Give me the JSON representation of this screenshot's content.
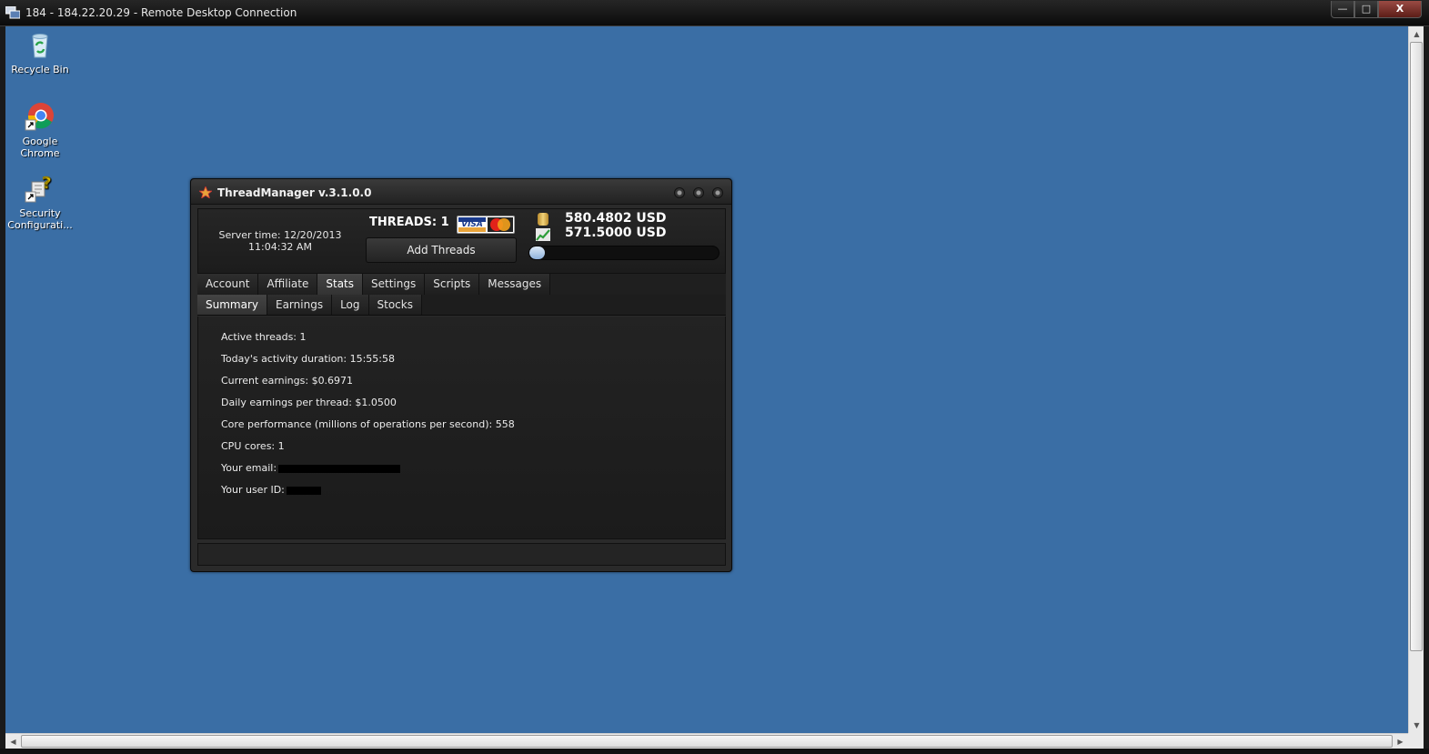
{
  "rdp": {
    "title": "184 - 184.22.20.29 - Remote Desktop Connection",
    "min_label": "—",
    "max_label": "□",
    "close_label": "X"
  },
  "desktop": {
    "background": "#3a6ea5",
    "icons": [
      {
        "label": "Recycle Bin",
        "icon": "recycle-bin-icon"
      },
      {
        "label": "Google Chrome",
        "icon": "chrome-icon"
      },
      {
        "label": "Security Configurati...",
        "icon": "security-config-icon"
      }
    ]
  },
  "app": {
    "title": "ThreadManager v.3.1.0.0",
    "server_time_line1": "Server time: 12/20/2013",
    "server_time_line2": "11:04:32 AM",
    "threads_label": "THREADS: 1",
    "visa_label": "VISA",
    "add_threads_label": "Add Threads",
    "balance": "580.4802 USD",
    "earned": "571.5000 USD",
    "progress_fraction": 0.08,
    "main_tabs": [
      "Account",
      "Affiliate",
      "Stats",
      "Settings",
      "Scripts",
      "Messages"
    ],
    "main_tab_active": "Stats",
    "sub_tabs": [
      "Summary",
      "Earnings",
      "Log",
      "Stocks"
    ],
    "sub_tab_active": "Summary",
    "stats": {
      "active_threads": "Active threads: 1",
      "activity_duration": "Today's activity duration: 15:55:58",
      "current_earnings": "Current earnings: $0.6971",
      "daily_earnings": "Daily earnings per thread: $1.0500",
      "core_performance": "Core performance (millions of operations per second): 558",
      "cpu_cores": "CPU cores: 1",
      "email_label": "Your email:",
      "user_id_label": "Your user ID:"
    }
  }
}
